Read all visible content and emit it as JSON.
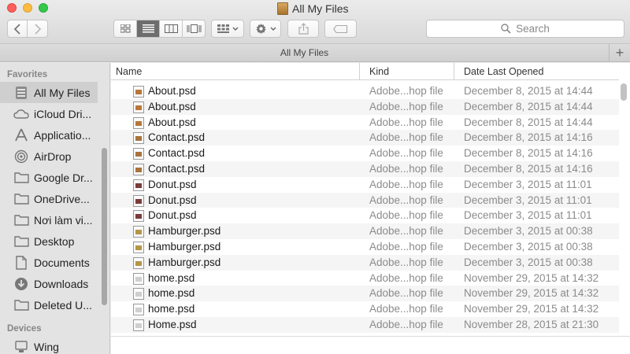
{
  "window": {
    "title": "All My Files"
  },
  "toolbar": {
    "search_label": "Search",
    "view_modes": [
      "icon-view",
      "list-view",
      "column-view",
      "cover-flow-view"
    ],
    "active_view": 1
  },
  "pathbar": {
    "label": "All My Files",
    "add": "+"
  },
  "sidebar": {
    "favorites_header": "Favorites",
    "items": [
      {
        "label": "All My Files",
        "icon": "all-files-icon"
      },
      {
        "label": "iCloud Dri...",
        "icon": "cloud-icon"
      },
      {
        "label": "Applicatio...",
        "icon": "applications-icon"
      },
      {
        "label": "AirDrop",
        "icon": "airdrop-icon"
      },
      {
        "label": "Google Dr...",
        "icon": "folder-icon"
      },
      {
        "label": "OneDrive...",
        "icon": "folder-icon"
      },
      {
        "label": "Nơi làm vi...",
        "icon": "folder-icon"
      },
      {
        "label": "Desktop",
        "icon": "folder-icon"
      },
      {
        "label": "Documents",
        "icon": "documents-icon"
      },
      {
        "label": "Downloads",
        "icon": "downloads-icon"
      },
      {
        "label": "Deleted U...",
        "icon": "folder-icon"
      }
    ],
    "devices_header": "Devices",
    "devices": [
      {
        "label": "Wing",
        "icon": "computer-icon"
      }
    ]
  },
  "columns": {
    "name": "Name",
    "kind": "Kind",
    "date": "Date Last Opened"
  },
  "files": [
    {
      "name": "About.psd",
      "kind": "Adobe...hop file",
      "date": "December 8, 2015 at 14:44",
      "thumb": "#b8773a"
    },
    {
      "name": "About.psd",
      "kind": "Adobe...hop file",
      "date": "December 8, 2015 at 14:44",
      "thumb": "#b8773a"
    },
    {
      "name": "About.psd",
      "kind": "Adobe...hop file",
      "date": "December 8, 2015 at 14:44",
      "thumb": "#b8773a"
    },
    {
      "name": "Contact.psd",
      "kind": "Adobe...hop file",
      "date": "December 8, 2015 at 14:16",
      "thumb": "#a8743c"
    },
    {
      "name": "Contact.psd",
      "kind": "Adobe...hop file",
      "date": "December 8, 2015 at 14:16",
      "thumb": "#a8743c"
    },
    {
      "name": "Contact.psd",
      "kind": "Adobe...hop file",
      "date": "December 8, 2015 at 14:16",
      "thumb": "#a8743c"
    },
    {
      "name": "Donut.psd",
      "kind": "Adobe...hop file",
      "date": "December 3, 2015 at 11:01",
      "thumb": "#7a3b3b"
    },
    {
      "name": "Donut.psd",
      "kind": "Adobe...hop file",
      "date": "December 3, 2015 at 11:01",
      "thumb": "#7a3b3b"
    },
    {
      "name": "Donut.psd",
      "kind": "Adobe...hop file",
      "date": "December 3, 2015 at 11:01",
      "thumb": "#7a3b3b"
    },
    {
      "name": "Hamburger.psd",
      "kind": "Adobe...hop file",
      "date": "December 3, 2015 at 00:38",
      "thumb": "#b59548"
    },
    {
      "name": "Hamburger.psd",
      "kind": "Adobe...hop file",
      "date": "December 3, 2015 at 00:38",
      "thumb": "#b59548"
    },
    {
      "name": "Hamburger.psd",
      "kind": "Adobe...hop file",
      "date": "December 3, 2015 at 00:38",
      "thumb": "#b59548"
    },
    {
      "name": "home.psd",
      "kind": "Adobe...hop file",
      "date": "November 29, 2015 at 14:32",
      "thumb": "#cfcfcf"
    },
    {
      "name": "home.psd",
      "kind": "Adobe...hop file",
      "date": "November 29, 2015 at 14:32",
      "thumb": "#cfcfcf"
    },
    {
      "name": "home.psd",
      "kind": "Adobe...hop file",
      "date": "November 29, 2015 at 14:32",
      "thumb": "#cfcfcf"
    },
    {
      "name": "Home.psd",
      "kind": "Adobe...hop file",
      "date": "November 28, 2015 at 21:30",
      "thumb": "#cfcfcf"
    }
  ]
}
